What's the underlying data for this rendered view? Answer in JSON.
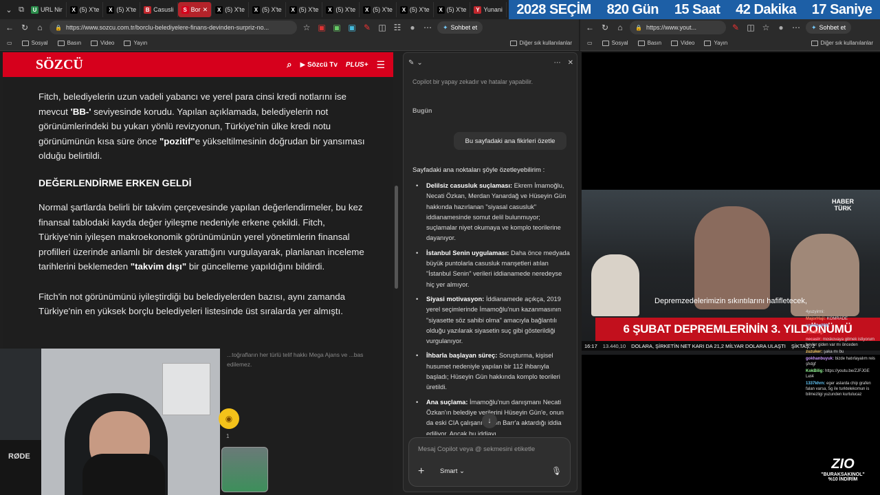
{
  "tabs": [
    {
      "label": "URL Nir",
      "fav": "U",
      "color": "#2a8c4a",
      "active": false
    },
    {
      "label": "(5) X'te",
      "fav": "X",
      "color": "#000000",
      "active": false
    },
    {
      "label": "(5) X'te",
      "fav": "X",
      "color": "#000000",
      "active": false
    },
    {
      "label": "Casusli",
      "fav": "B",
      "color": "#c0272d",
      "active": false
    },
    {
      "label": "Bor",
      "fav": "S",
      "color": "#d6001c",
      "active": true
    },
    {
      "label": "(5) X'te",
      "fav": "X",
      "color": "#000000",
      "active": false
    },
    {
      "label": "(5) X'te",
      "fav": "X",
      "color": "#000000",
      "active": false
    },
    {
      "label": "(5) X'te",
      "fav": "X",
      "color": "#000000",
      "active": false
    },
    {
      "label": "(5) X'te",
      "fav": "X",
      "color": "#000000",
      "active": false
    },
    {
      "label": "(5) X'te",
      "fav": "X",
      "color": "#000000",
      "active": false
    },
    {
      "label": "(5) X'te",
      "fav": "X",
      "color": "#000000",
      "active": false
    },
    {
      "label": "(5) X'te",
      "fav": "X",
      "color": "#000000",
      "active": false
    },
    {
      "label": "Yunani",
      "fav": "Y",
      "color": "#c0272d",
      "active": false
    }
  ],
  "countdown": {
    "year": "2028",
    "label": "SEÇİM",
    "days": "820 Gün",
    "hours": "15 Saat",
    "minutes": "42 Dakika",
    "seconds": "17 Saniye"
  },
  "left_window": {
    "url": "https://www.sozcu.com.tr/borclu-belediyelere-finans-devinden-surpriz-no...",
    "copilot_chip": "Sohbet et",
    "bookmarks": [
      "Sosyal",
      "Basın",
      "Video",
      "Yayın"
    ],
    "other_bookmarks": "Diğer sık kullanılanlar"
  },
  "right_window": {
    "url": "https://www.yout...",
    "copilot_chip": "Sohbet et",
    "bookmarks": [
      "Sosyal",
      "Basın",
      "Video",
      "Yayın"
    ],
    "other_bookmarks": "Diğer sık kullanılanlar"
  },
  "sozcu": {
    "logo": "SÖZCÜ",
    "tv": "Sözcü Tv",
    "plus": "PLUS+",
    "p1_a": "Fitch, belediyelerin uzun vadeli yabancı ve yerel para cinsi kredi notlarını ise mevcut ",
    "p1_b": "'BB-'",
    "p1_c": " seviyesinde korudu. Yapılan açıklamada, belediyelerin not görünümlerindeki bu yukarı yönlü revizyonun, Türkiye'nin ülke kredi notu görünümünün kısa süre önce ",
    "p1_d": "\"pozitif\"",
    "p1_e": "e yükseltilmesinin doğrudan bir yansıması olduğu belirtildi.",
    "heading": "DEĞERLENDİRME ERKEN GELDİ",
    "p2_a": "Normal şartlarda belirli bir takvim çerçevesinde yapılan değerlendirmeler, bu kez finansal tablodaki kayda değer iyileşme nedeniyle erkene çekildi. Fitch, Türkiye'nin iyileşen makroekonomik görünümünün yerel yönetimlerin finansal profilleri üzerinde anlamlı bir destek yarattığını vurgulayarak, planlanan inceleme tarihlerini beklemeden ",
    "p2_b": "\"takvim dışı\"",
    "p2_c": " bir güncelleme yapıldığını bildirdi.",
    "p3": "Fitch'in not görünümünü iyileştirdiği bu belediyelerden bazısı, aynı zamanda Türkiye'nin en yüksek borçlu belediyeleri listesinde üst sıralarda yer almıştı.",
    "caption": "...toğrafların her türlü telif hakkı Mega Ajans ve ...bas edilemez."
  },
  "webcam": {
    "mic_brand": "RØDE",
    "reaction_count": "1"
  },
  "copilot": {
    "disclaimer": "Copilot bir yapay zekadır ve hatalar yapabilir.",
    "today": "Bugün",
    "user_message": "Bu sayfadaki ana fikirleri özetle",
    "intro": "Sayfadaki ana noktaları şöyle özetleyebilirim :",
    "items": [
      {
        "title": "Delilsiz casusluk suçlaması:",
        "text": " Ekrem İmamoğlu, Necati Özkan, Merdan Yanardağ ve Hüseyin Gün hakkında hazırlanan \"siyasal casusluk\" iddianamesinde somut delil bulunmuyor; suçlamalar niyet okumaya ve komplo teorilerine dayanıyor."
      },
      {
        "title": "İstanbul Senin uygulaması:",
        "text": " Daha önce medyada büyük puntolarla casusluk manşetleri atılan \"İstanbul Senin\" verileri iddianamede neredeyse hiç yer almıyor."
      },
      {
        "title": "Siyasi motivasyon:",
        "text": " İddianamede açıkça, 2019 yerel seçimlerinde İmamoğlu'nun kazanmasının \"siyasette söz sahibi olma\" amacıyla bağlantılı olduğu yazılarak siyasetin suç gibi gösterildiği vurgulanıyor."
      },
      {
        "title": "İhbarla başlayan süreç:",
        "text": " Soruşturma, kişisel husumet nedeniyle yapılan bir 112 ihbarıyla başladı; Hüseyin Gün hakkında komplo teorileri üretildi."
      },
      {
        "title": "Ana suçlama:",
        "text": " İmamoğlu'nun danışmanı Necati Özkan'ın belediye verilerini Hüseyin Gün'e, onun da eski CIA çalışanı Aaron Barr'a aktardığı iddia ediliyor. Ancak bu iddiayı"
      }
    ],
    "input_placeholder": "Mesaj Copilot veya @ sekmesini etiketle",
    "mode": "Smart"
  },
  "video": {
    "brand_top": "HABER",
    "brand_bottom": "TÜRK",
    "subtitle": "Depremzedelerimizin sıkıntılarını hafifletecek,",
    "headline": "6 ŞUBAT DEPREMLERİNİN 3. YILDÖNÜMÜ",
    "ticker_time": "16:17",
    "ticker_index": "13.440,10",
    "ticker_text": "DOLARA, ŞİRKETİN NET KARI DA 21,2 MİLYAR DOLARA ULAŞTI",
    "ticker_tail": "ŞİKTAŞ, 2"
  },
  "chat": [
    {
      "user": "",
      "text": "4yuzyirmi:"
    },
    {
      "user": "MajorHaji:",
      "text": "KOMRADE"
    },
    {
      "user": "snowball08:",
      "text": ""
    },
    {
      "user": "KokBilig:",
      "text": ""
    },
    {
      "user": "necaslr:",
      "text": "moskovaya gitmek istiyorum beyler giden var mı önceden"
    },
    {
      "user": "zuzuker:",
      "text": "şaka mı bu"
    },
    {
      "user": "gokhanbuyuk:",
      "text": "bizde hatırlayalım reis şhdgf"
    },
    {
      "user": "KokBilig:",
      "text": "https://youtu.be/ZJFJGE Let4"
    },
    {
      "user": "1337khrn:",
      "text": "eger aslarda chip grafen falan varsa, 5g ile turktelekomun is bilmezligi yuzunden kurtulucaz"
    }
  ],
  "promo": {
    "logo": "ZIO",
    "code": "\"BURAKSAKINOL\"",
    "discount": "%10 İNDİRİM"
  }
}
